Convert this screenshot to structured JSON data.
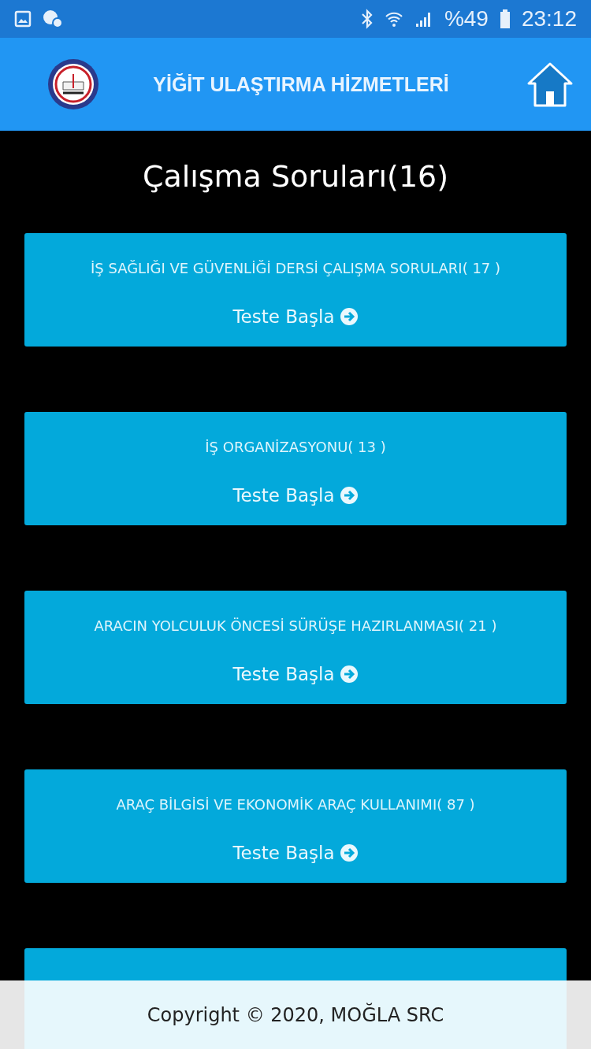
{
  "status_bar": {
    "battery": "%49",
    "time": "23:12"
  },
  "header": {
    "title": "YİĞİT ULAŞTIRMA HİZMETLERİ"
  },
  "page_title": "Çalışma Soruları(16)",
  "cards": [
    {
      "title": "İŞ SAĞLIĞI VE GÜVENLİĞİ DERSİ ÇALIŞMA SORULARI( 17 )",
      "button": "Teste Başla"
    },
    {
      "title": "İŞ ORGANİZASYONU( 13 )",
      "button": "Teste Başla"
    },
    {
      "title": "ARACIN YOLCULUK ÖNCESİ SÜRÜŞE HAZIRLANMASI( 21 )",
      "button": "Teste Başla"
    },
    {
      "title": "ARAÇ BİLGİSİ VE EKONOMİK ARAÇ KULLANIMI( 87 )",
      "button": "Teste Başla"
    }
  ],
  "footer": {
    "text": "Copyright © 2020, MOĞLA SRC"
  }
}
